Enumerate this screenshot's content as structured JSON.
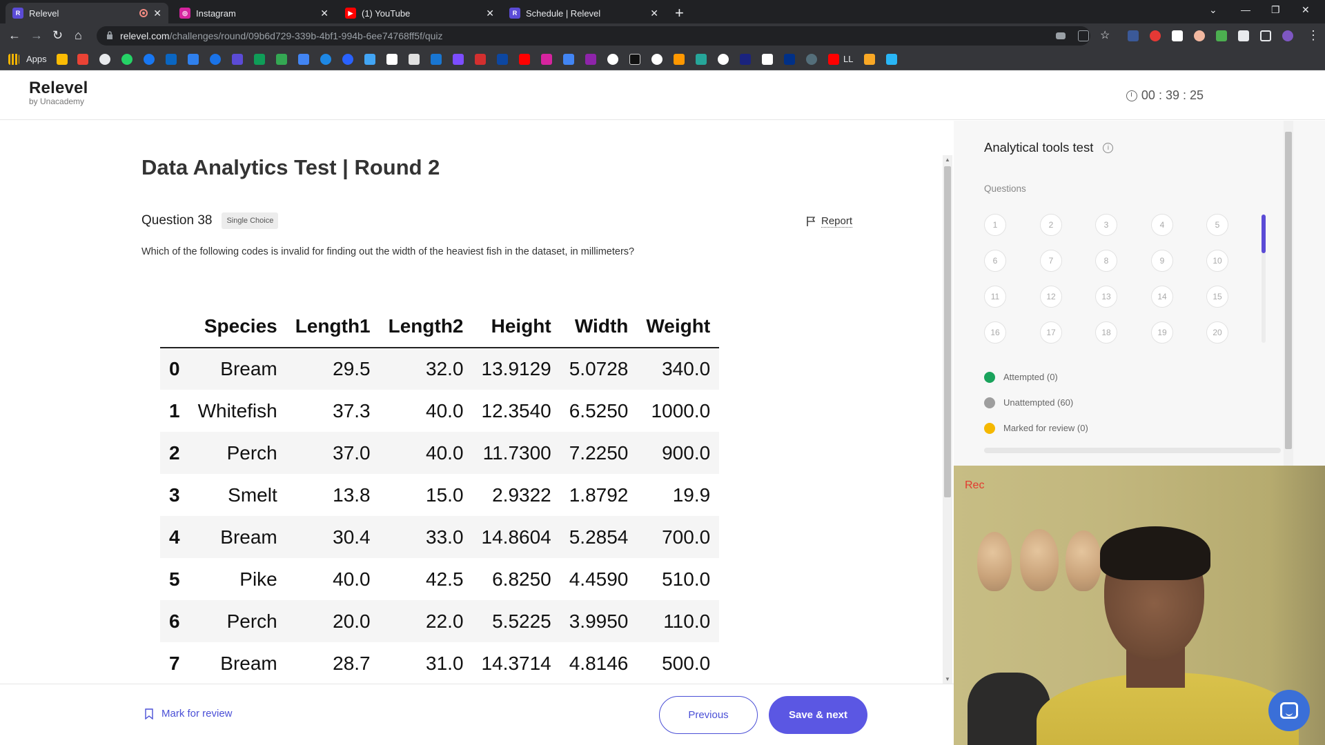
{
  "browser": {
    "tabs": [
      {
        "title": "Relevel",
        "favicon": "R",
        "color": "#5b4bd6",
        "active": true
      },
      {
        "title": "Instagram",
        "favicon": "ig",
        "color": "#d6249f",
        "active": false
      },
      {
        "title": "(1) YouTube",
        "favicon": "yt",
        "color": "#ff0000",
        "active": false
      },
      {
        "title": "Schedule | Relevel",
        "favicon": "R",
        "color": "#5b4bd6",
        "active": false
      }
    ],
    "url_host": "relevel.com",
    "url_path": "/challenges/round/09b6d729-339b-4bf1-994b-6ee74768ff5f/quiz",
    "bookmarks_apps_label": "Apps",
    "bookmark_ll_label": "LL"
  },
  "header": {
    "brand": "Relevel",
    "brand_sub": "by Unacademy",
    "timer": "00 : 39 : 25"
  },
  "main": {
    "test_title": "Data Analytics Test | Round 2",
    "question_number": "Question 38",
    "question_type": "Single Choice",
    "report_label": "Report",
    "question_text": "Which of the following codes is invalid for finding out the width of the heaviest fish in the dataset, in millimeters?"
  },
  "table": {
    "columns": [
      "",
      "Species",
      "Length1",
      "Length2",
      "Height",
      "Width",
      "Weight"
    ],
    "rows": [
      [
        "0",
        "Bream",
        "29.5",
        "32.0",
        "13.9129",
        "5.0728",
        "340.0"
      ],
      [
        "1",
        "Whitefish",
        "37.3",
        "40.0",
        "12.3540",
        "6.5250",
        "1000.0"
      ],
      [
        "2",
        "Perch",
        "37.0",
        "40.0",
        "11.7300",
        "7.2250",
        "900.0"
      ],
      [
        "3",
        "Smelt",
        "13.8",
        "15.0",
        "2.9322",
        "1.8792",
        "19.9"
      ],
      [
        "4",
        "Bream",
        "30.4",
        "33.0",
        "14.8604",
        "5.2854",
        "700.0"
      ],
      [
        "5",
        "Pike",
        "40.0",
        "42.5",
        "6.8250",
        "4.4590",
        "510.0"
      ],
      [
        "6",
        "Perch",
        "20.0",
        "22.0",
        "5.5225",
        "3.9950",
        "110.0"
      ],
      [
        "7",
        "Bream",
        "28.7",
        "31.0",
        "14.3714",
        "4.8146",
        "500.0"
      ]
    ]
  },
  "footer": {
    "mark_review_label": "Mark for review",
    "previous_label": "Previous",
    "next_label": "Save & next"
  },
  "side": {
    "title": "Analytical tools test",
    "questions_label": "Questions",
    "question_numbers": [
      "1",
      "2",
      "3",
      "4",
      "5",
      "6",
      "7",
      "8",
      "9",
      "10",
      "11",
      "12",
      "13",
      "14",
      "15",
      "16",
      "17",
      "18",
      "19",
      "20"
    ],
    "legend": [
      {
        "label": "Attempted (0)",
        "color": "#1aa35c"
      },
      {
        "label": "Unattempted (60)",
        "color": "#9e9e9e"
      },
      {
        "label": "Marked for review (0)",
        "color": "#f5b800"
      }
    ]
  },
  "webcam": {
    "rec_label": "Rec"
  }
}
